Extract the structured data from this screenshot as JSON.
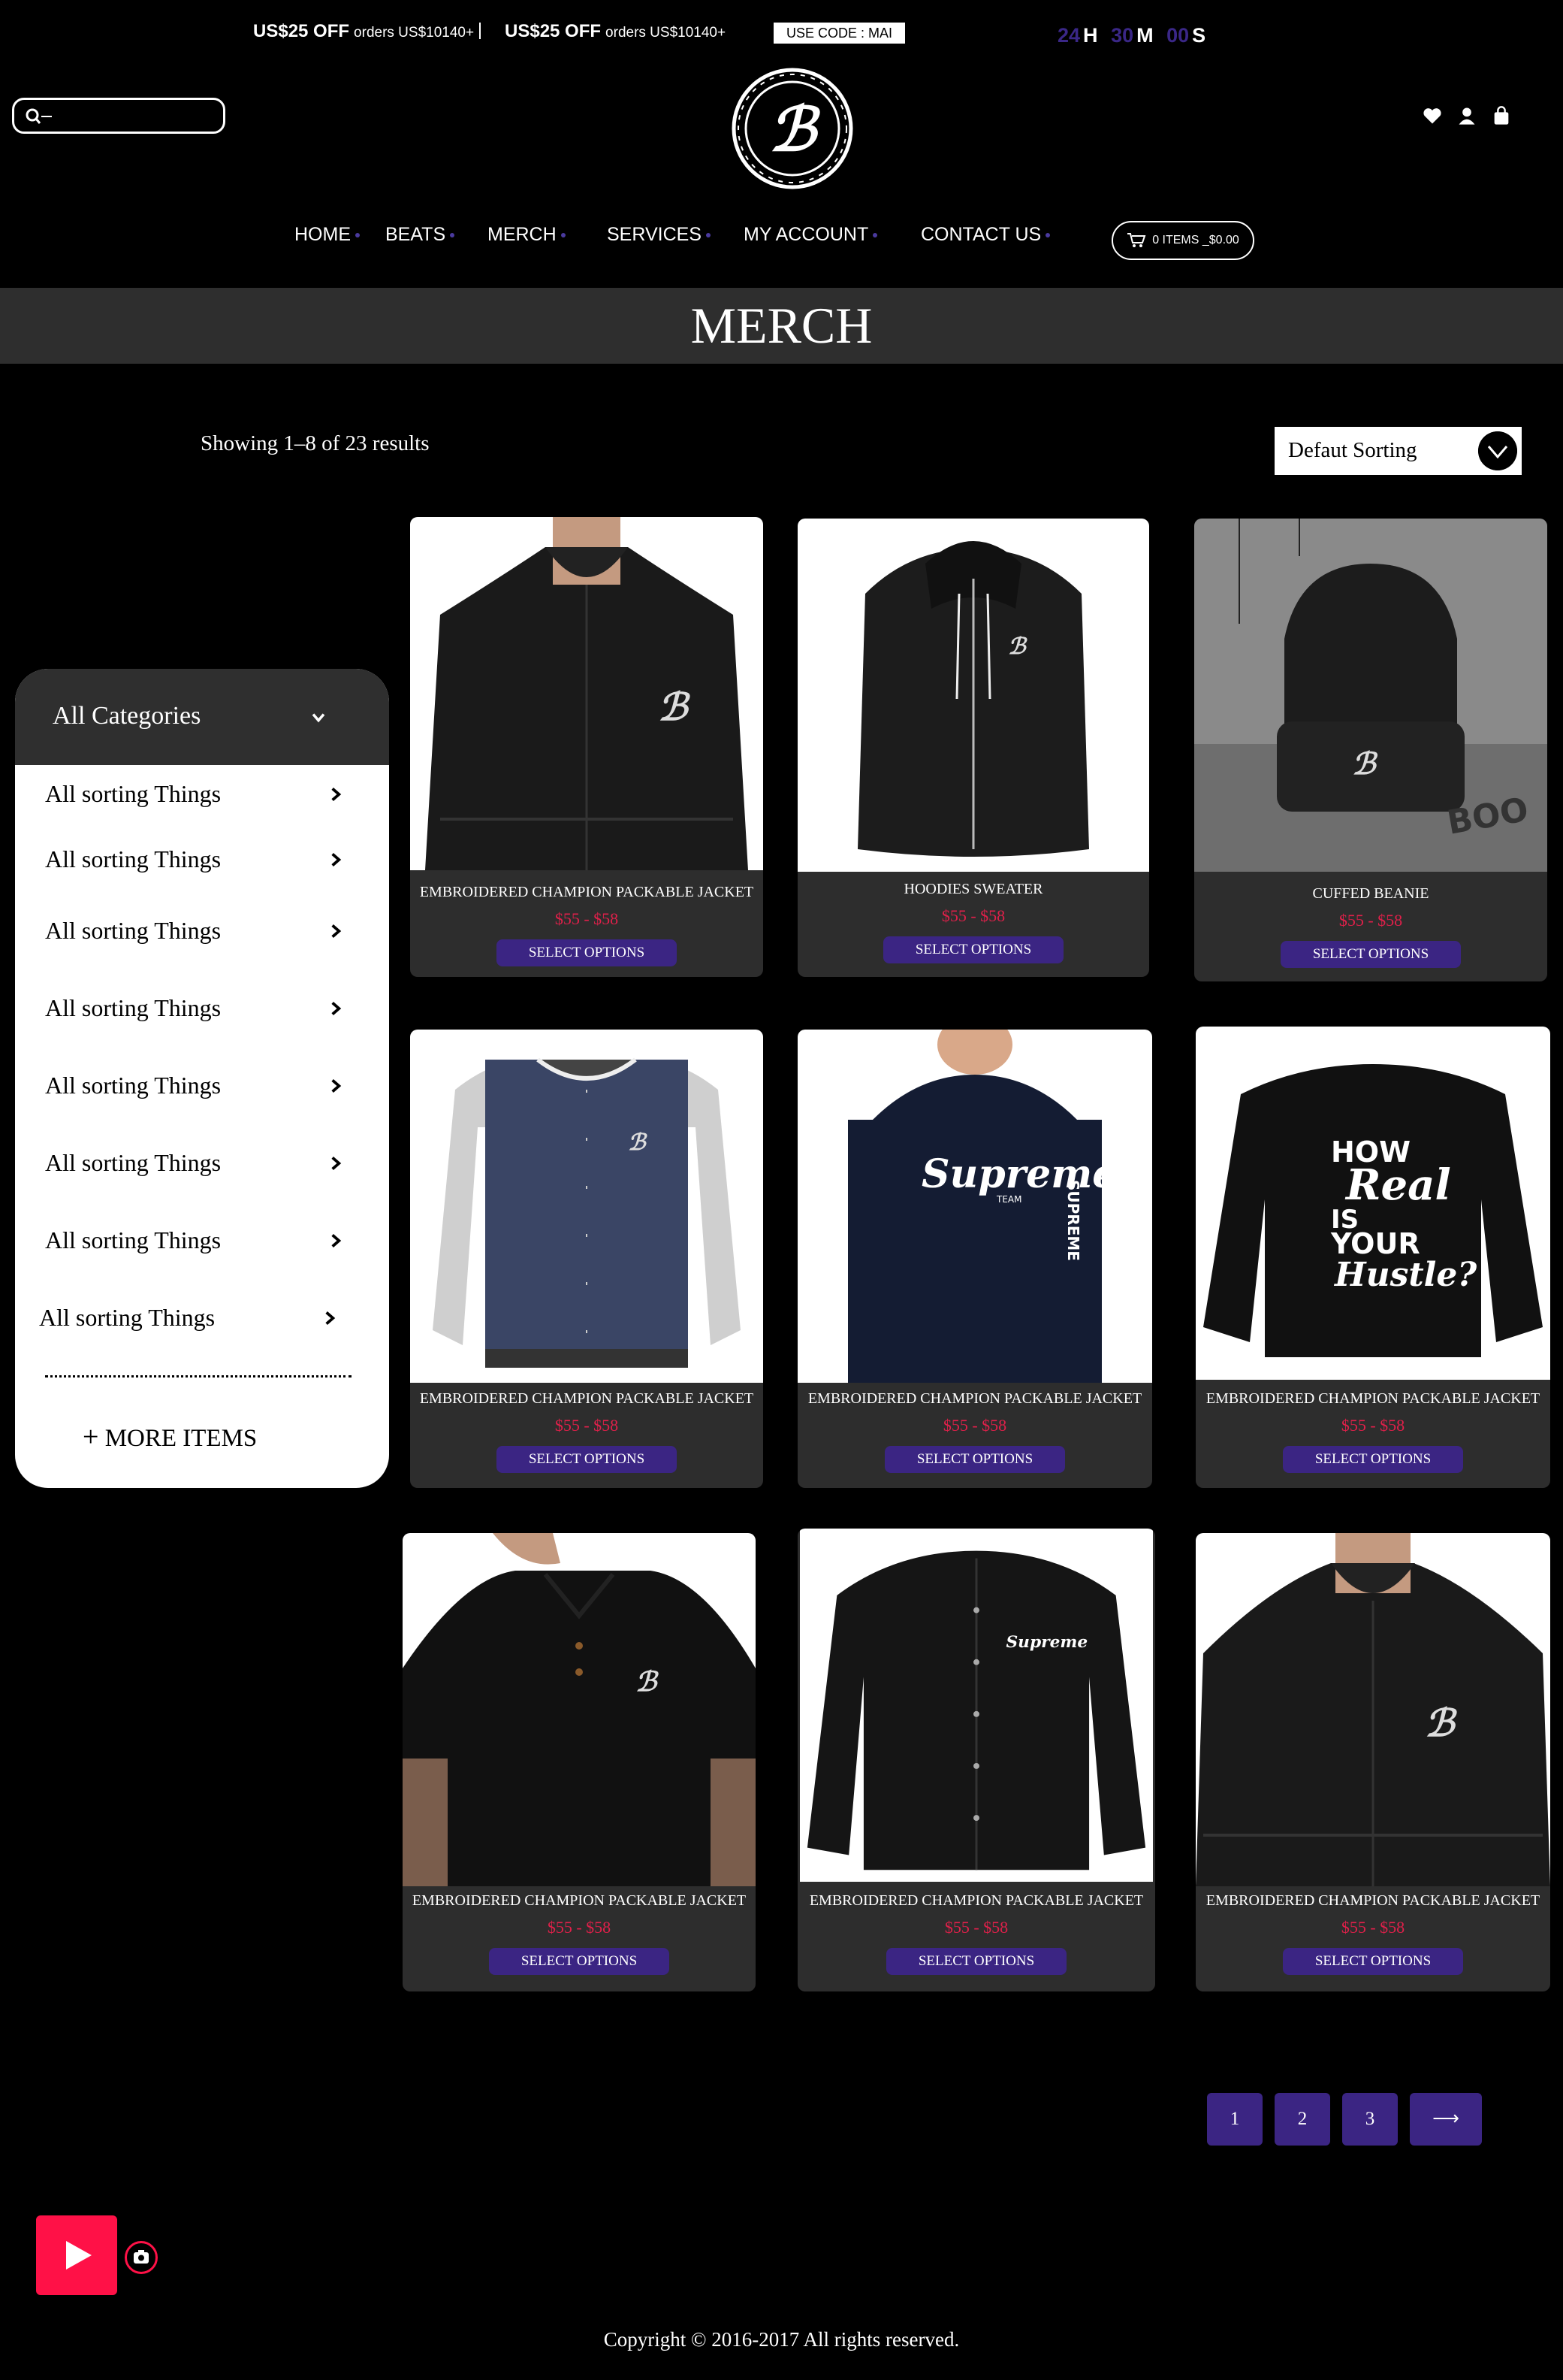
{
  "promo": {
    "offers": [
      {
        "amount": "US$25 OFF",
        "condition": "orders US$10140+"
      },
      {
        "amount": "US$25 OFF",
        "condition": "orders US$10140+"
      }
    ],
    "code": "USE CODE : MAI",
    "countdown": [
      {
        "value": "24",
        "unit": "H"
      },
      {
        "value": "30",
        "unit": "M"
      },
      {
        "value": "00",
        "unit": "S"
      }
    ]
  },
  "header": {
    "search": {
      "value": "",
      "placeholder": ""
    },
    "icons": [
      "heart-icon",
      "user-icon",
      "bag-icon"
    ]
  },
  "nav": {
    "items": [
      {
        "label": "HOME"
      },
      {
        "label": "BEATS"
      },
      {
        "label": "MERCH"
      },
      {
        "label": "SERVICES"
      },
      {
        "label": "MY ACCOUNT"
      },
      {
        "label": "CONTACT US"
      }
    ],
    "cart": "0 ITEMS _$0.00"
  },
  "page": {
    "title": "MERCH",
    "results": "Showing 1–8 of 23 results",
    "sorting": "Defaut Sorting"
  },
  "sidebar": {
    "header": "All Categories",
    "items": [
      {
        "label": "All sorting Things"
      },
      {
        "label": "All sorting Things"
      },
      {
        "label": "All sorting Things"
      },
      {
        "label": "All sorting Things"
      },
      {
        "label": "All sorting Things"
      },
      {
        "label": "All sorting Things"
      },
      {
        "label": "All sorting Things"
      },
      {
        "label": "All sorting Things"
      }
    ],
    "more": "MORE ITEMS"
  },
  "products": [
    {
      "name": "EMBROIDERED CHAMPION PACKABLE JACKET",
      "price": "$55 - $58",
      "button": "SELECT OPTIONS"
    },
    {
      "name": "HOODIES SWEATER",
      "price": "$55 - $58",
      "button": "SELECT OPTIONS"
    },
    {
      "name": "CUFFED BEANIE",
      "price": "$55 - $58",
      "button": "SELECT OPTIONS"
    },
    {
      "name": "EMBROIDERED CHAMPION PACKABLE JACKET",
      "price": "$55 - $58",
      "button": "SELECT OPTIONS"
    },
    {
      "name": "EMBROIDERED CHAMPION PACKABLE JACKET",
      "price": "$55 - $58",
      "button": "SELECT OPTIONS"
    },
    {
      "name": "EMBROIDERED CHAMPION PACKABLE JACKET",
      "price": "$55 - $58",
      "button": "SELECT OPTIONS"
    },
    {
      "name": "EMBROIDERED CHAMPION PACKABLE JACKET",
      "price": "$55 - $58",
      "button": "SELECT OPTIONS"
    },
    {
      "name": "EMBROIDERED CHAMPION PACKABLE JACKET",
      "price": "$55 - $58",
      "button": "SELECT OPTIONS"
    },
    {
      "name": "EMBROIDERED CHAMPION PACKABLE JACKET",
      "price": "$55 - $58",
      "button": "SELECT OPTIONS"
    }
  ],
  "image_text": {
    "beanie": "BOO",
    "tee_supreme": "Supreme",
    "tee_supreme_sub": "TEAM",
    "tee_sleeve": "SUPREME",
    "hustle_lines": [
      "HOW",
      "Real",
      "IS",
      "YOUR",
      "Hustle?"
    ],
    "bomber": "Supreme"
  },
  "pagination": {
    "pages": [
      "1",
      "2",
      "3"
    ],
    "next": "⟶"
  },
  "footer": {
    "copyright": "Copyright © 2016-2017 All rights reserved."
  },
  "colors": {
    "accent": "#3b2583",
    "price": "#e0204a",
    "video": "#ff1147",
    "band": "#2e2e2e",
    "card": "#2d2d2d"
  }
}
